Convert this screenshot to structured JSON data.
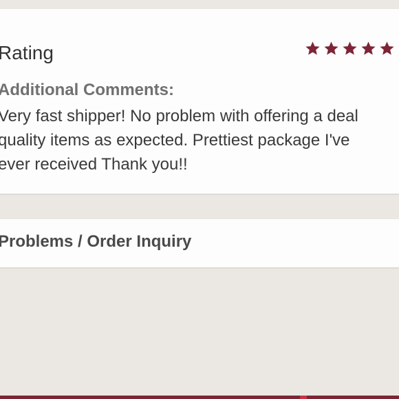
{
  "rating_section": {
    "title": "Rating",
    "stars_filled": 5,
    "stars_total": 5,
    "star_color": "#7d2537"
  },
  "comments": {
    "label": "Additional Comments:",
    "lines": [
      "Very fast shipper! No problem with offering a deal",
      "quality items as expected. Prettiest package I've",
      "ever received Thank you!!"
    ]
  },
  "problems": {
    "title": "Problems / Order Inquiry"
  },
  "colors": {
    "background": "#ebe8e4",
    "card": "#fdfdfd",
    "accent_bar": "#7a2634"
  }
}
